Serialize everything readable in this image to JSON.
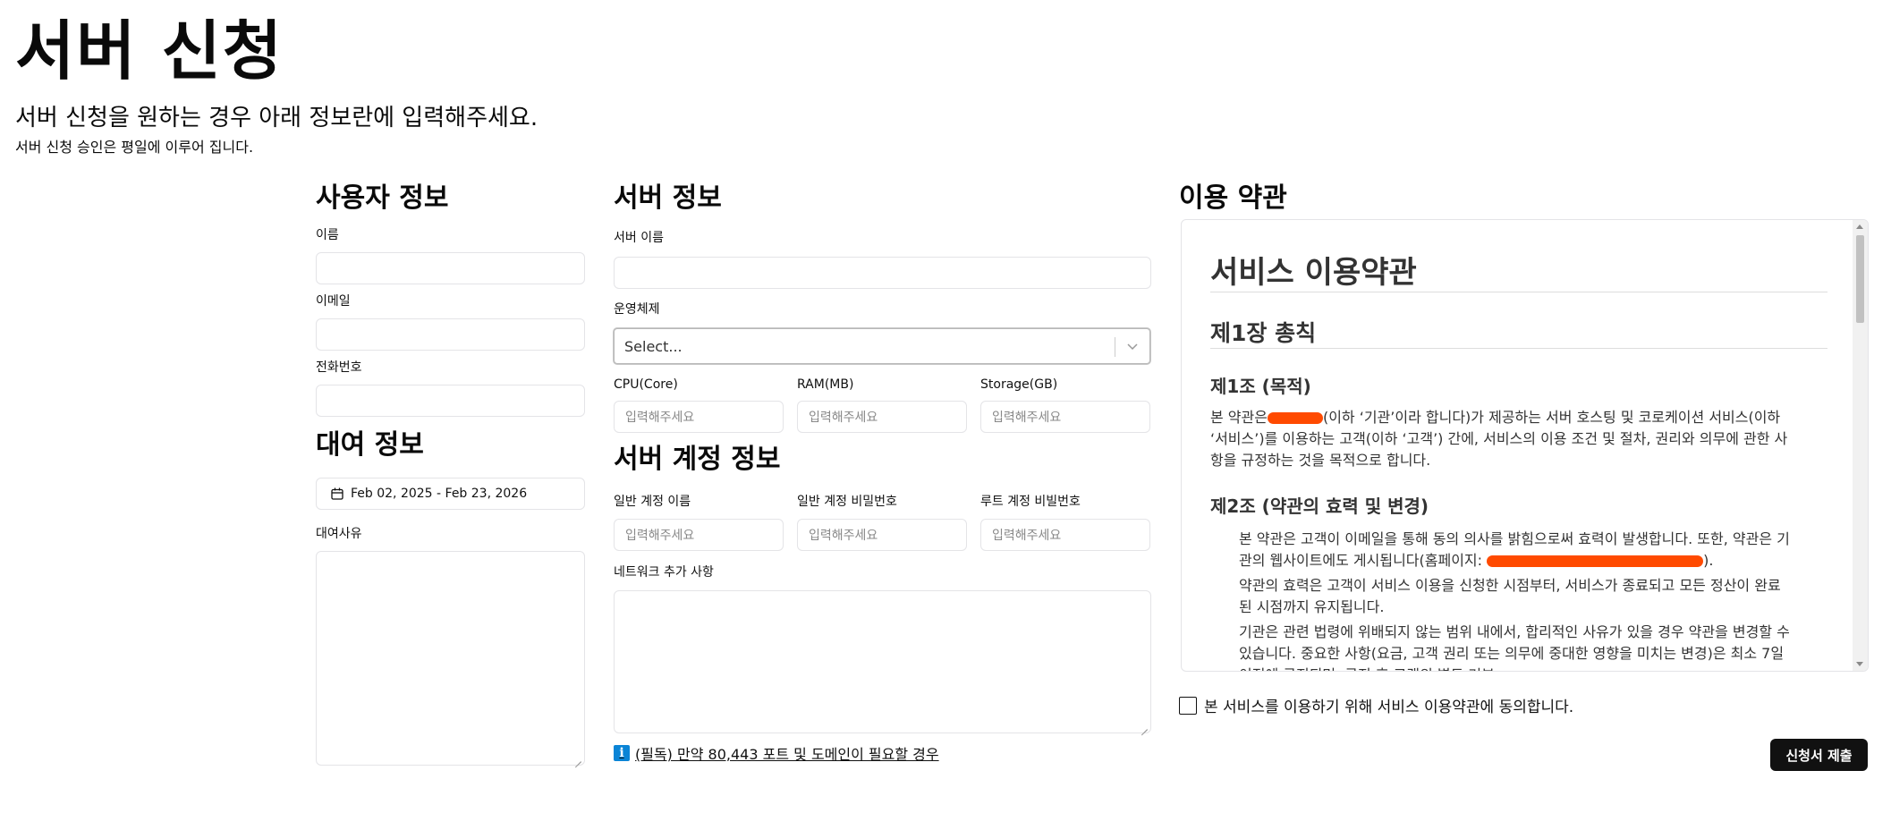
{
  "header": {
    "title": "서버 신청",
    "subtitle": "서버 신청을 원하는 경우 아래 정보란에 입력해주세요.",
    "note": "서버 신청 승인은 평일에 이루어 집니다."
  },
  "user_info": {
    "title": "사용자 정보",
    "name_label": "이름",
    "email_label": "이메일",
    "phone_label": "전화번호"
  },
  "rental_info": {
    "title": "대여 정보",
    "date_range": "Feb 02, 2025 - Feb 23, 2026",
    "reason_label": "대여사유"
  },
  "server_info": {
    "title": "서버 정보",
    "server_name_label": "서버 이름",
    "os_label": "운영체제",
    "os_placeholder": "Select...",
    "cpu_label": "CPU(Core)",
    "ram_label": "RAM(MB)",
    "storage_label": "Storage(GB)",
    "input_placeholder": "입력해주세요"
  },
  "account_info": {
    "title": "서버 계정 정보",
    "user_account_label": "일반 계정 이름",
    "user_password_label": "일반 계정 비밀번호",
    "root_password_label": "루트 계정 비빌번호",
    "input_placeholder": "입력해주세요",
    "network_label": "네트워크 추가 사항",
    "info_icon": "i",
    "info_link": "(필독) 만약 80,443 포트 및 도메인이 필요할 경우"
  },
  "terms": {
    "title": "이용 약관",
    "doc_title": "서비스 이용약관",
    "chapter1": "제1장 총칙",
    "art1_title": "제1조 (목적)",
    "art1_text_a": "본 약관은",
    "art1_text_b": "(이하 ‘기관’이라 합니다)가 제공하는 서버 호스팅 및 코로케이션 서비스(이하",
    "art1_text_c": "‘서비스’)를 이용하는 고객(이하 ‘고객’) 간에, 서비스의 이용 조건 및 절차, 권리와 의무에 관한 사",
    "art1_text_d": "항을 규정하는 것을 목적으로 합니다.",
    "art2_title": "제2조 (약관의 효력 및 변경)",
    "art2_p1_a": "본 약관은 고객이 이메일을 통해 동의 의사를 밝힘으로써 효력이 발생합니다. 또한, 약관은 기",
    "art2_p1_b": "관의 웹사이트에도 게시됩니다(홈페이지:",
    "art2_p1_c": ").",
    "art2_p2_a": "약관의 효력은 고객이 서비스 이용을 신청한 시점부터, 서비스가 종료되고 모든 정산이 완료",
    "art2_p2_b": "된 시점까지 유지됩니다.",
    "art2_p3_a": "기관은 관련 법령에 위배되지 않는 범위 내에서, 합리적인 사유가 있을 경우 약관을 변경할 수",
    "art2_p3_b": "있습니다. 중요한 사항(요금, 고객 권리 또는 의무에 중대한 영향을 미치는 변경)은 최소 7일",
    "art2_p3_c": "이전에 공지되며, 공지 후 고객의 별도 거부",
    "agree_label": "본 서비스를 이용하기 위해 서비스 이용약관에 동의합니다."
  },
  "submit_label": "신청서 제출",
  "colors": {
    "accent": "#0a84d6",
    "redaction": "#ff4a00",
    "button_bg": "#111111"
  }
}
